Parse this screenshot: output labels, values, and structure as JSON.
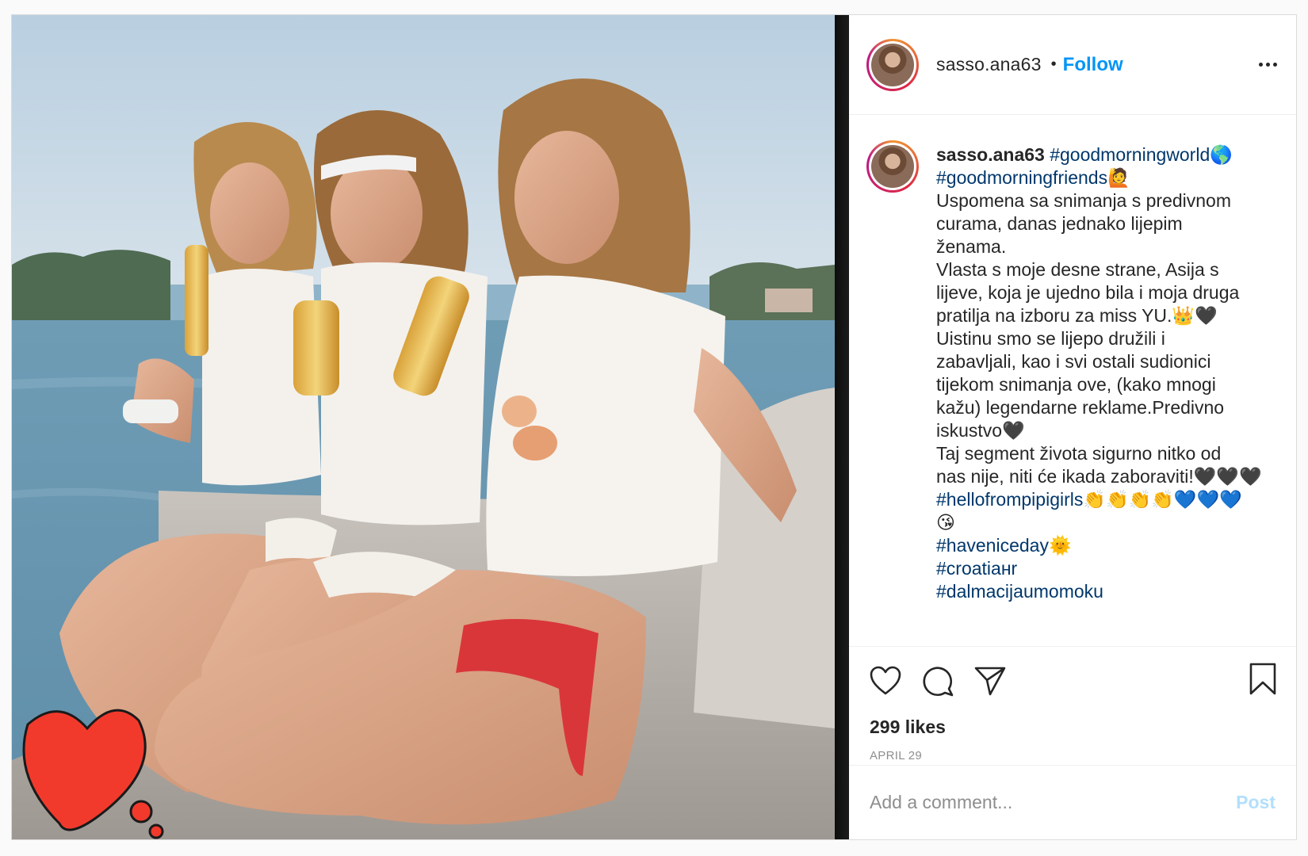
{
  "post": {
    "photo": {
      "alt_icon": "photo-of-three-women",
      "sticker": "heart-sticker-icon"
    },
    "header": {
      "username": "sasso.ana63",
      "separator": "•",
      "follow_label": "Follow",
      "more_icon": "more-options-icon"
    },
    "caption": {
      "username": "sasso.ana63",
      "lines": [
        [
          {
            "t": "tag",
            "v": "#goodmorningworld🌎"
          }
        ],
        [
          {
            "t": "tag",
            "v": "#goodmorningfriends🙋"
          }
        ],
        [
          {
            "t": "text",
            "v": "Uspomena sa snimanja s predivnom"
          }
        ],
        [
          {
            "t": "text",
            "v": "curama, danas jednako lijepim"
          }
        ],
        [
          {
            "t": "text",
            "v": "ženama."
          }
        ],
        [
          {
            "t": "text",
            "v": "Vlasta s moje desne strane, Asija s"
          }
        ],
        [
          {
            "t": "text",
            "v": "lijeve, koja je ujedno bila i moja druga"
          }
        ],
        [
          {
            "t": "text",
            "v": "pratilja na izboru za miss YU.👑🖤"
          }
        ],
        [
          {
            "t": "text",
            "v": "Uistinu smo se lijepo družili i"
          }
        ],
        [
          {
            "t": "text",
            "v": "zabavljali, kao i svi ostali sudionici"
          }
        ],
        [
          {
            "t": "text",
            "v": "tijekom snimanja ove, (kako mnogi"
          }
        ],
        [
          {
            "t": "text",
            "v": "kažu) legendarne reklame.Predivno"
          }
        ],
        [
          {
            "t": "text",
            "v": "iskustvo🖤"
          }
        ],
        [
          {
            "t": "text",
            "v": "Taj segment života sigurno nitko od"
          }
        ],
        [
          {
            "t": "text",
            "v": "nas nije, niti će ikada zaboraviti!🖤🖤🖤"
          }
        ],
        [
          {
            "t": "tag",
            "v": "#hellofrompipigirls"
          },
          {
            "t": "text",
            "v": "👏👏👏👏💙💙💙"
          }
        ],
        [
          {
            "t": "text",
            "v": "😘"
          }
        ],
        [
          {
            "t": "tag",
            "v": "#haveniceday🌞"
          }
        ],
        [
          {
            "t": "tag",
            "v": "#croatiaнr"
          }
        ],
        [
          {
            "t": "tag",
            "v": "#dalmacijaumomoku"
          }
        ]
      ]
    },
    "actions": {
      "like_icon": "heart-outline-icon",
      "comment_icon": "comment-bubble-icon",
      "share_icon": "paper-plane-icon",
      "save_icon": "bookmark-icon",
      "likes_text": "299 likes",
      "date": "APRIL 29"
    },
    "comment_box": {
      "placeholder": "Add a comment...",
      "post_label": "Post"
    }
  },
  "colors": {
    "accent": "#0095f6",
    "hashtag": "#00376b",
    "post_disabled": "#b2dffc",
    "muted": "#8e8e8e",
    "sticker_red": "#f23a2c"
  }
}
